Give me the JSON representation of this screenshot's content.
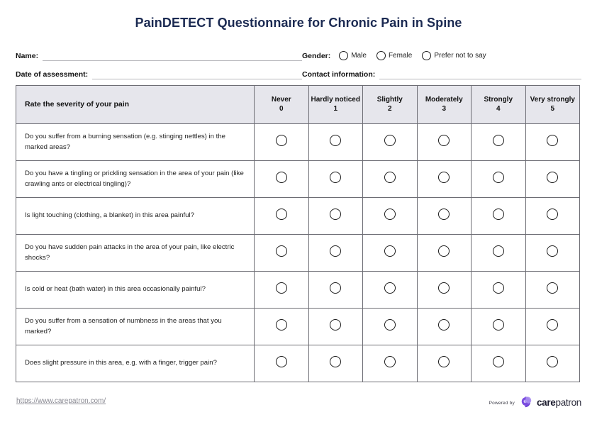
{
  "document": {
    "title": "PainDETECT Questionnaire for Chronic Pain in Spine",
    "title_color": "#1b2a52"
  },
  "form": {
    "name_label": "Name:",
    "name_value": "",
    "date_label": "Date of assessment:",
    "date_value": "",
    "gender_label": "Gender:",
    "gender_options": [
      {
        "label": "Male",
        "selected": false
      },
      {
        "label": "Female",
        "selected": false
      },
      {
        "label": "Prefer not to say",
        "selected": false
      }
    ],
    "contact_label": "Contact information:",
    "contact_value": ""
  },
  "table": {
    "header_bg": "#e6e6ec",
    "first_column_header": "Rate the severity of your pain",
    "scale": [
      {
        "label": "Never",
        "value": "0"
      },
      {
        "label": "Hardly noticed",
        "value": "1"
      },
      {
        "label": "Slightly",
        "value": "2"
      },
      {
        "label": "Moderately",
        "value": "3"
      },
      {
        "label": "Strongly",
        "value": "4"
      },
      {
        "label": "Very strongly",
        "value": "5"
      }
    ],
    "questions": [
      "Do you suffer from a burning sensation (e.g. stinging nettles) in the marked areas?",
      "Do you have a tingling or prickling sensation in the area of your pain (like crawling ants or electrical tingling)?",
      "Is light touching (clothing, a blanket) in this area painful?",
      "Do you have sudden pain attacks in the area of your pain, like electric shocks?",
      "Is cold or heat (bath water) in this area occasionally painful?",
      "Do you suffer from a sensation of numbness in the areas that you marked?",
      "Does slight pressure in this area, e.g. with a finger, trigger pain?"
    ]
  },
  "footer": {
    "url": "https://www.carepatron.com/",
    "powered_by": "Powered by",
    "brand_bold": "care",
    "brand_light": "patron",
    "brand_color": "#7b4ce0"
  }
}
